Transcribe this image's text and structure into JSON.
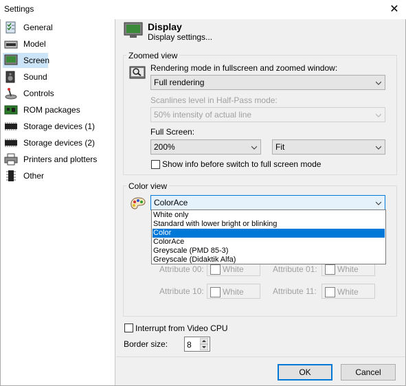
{
  "window": {
    "title": "Settings",
    "close_glyph": "✕"
  },
  "sidebar": {
    "items": [
      {
        "label": "General",
        "icon": "general-checklist-icon"
      },
      {
        "label": "Model",
        "icon": "computer-model-icon"
      },
      {
        "label": "Screen",
        "icon": "monitor-screen-icon",
        "selected": true
      },
      {
        "label": "Sound",
        "icon": "speaker-icon"
      },
      {
        "label": "Controls",
        "icon": "joystick-icon"
      },
      {
        "label": "ROM packages",
        "icon": "circuit-board-icon"
      },
      {
        "label": "Storage devices (1)",
        "icon": "chip-icon"
      },
      {
        "label": "Storage devices (2)",
        "icon": "chip-icon"
      },
      {
        "label": "Printers and plotters",
        "icon": "printer-icon"
      },
      {
        "label": "Other",
        "icon": "ic-chip-icon"
      }
    ]
  },
  "header": {
    "title": "Display",
    "subtitle": "Display settings..."
  },
  "zoomed": {
    "group_label": "Zoomed view",
    "rendering_label": "Rendering mode in fullscreen and zoomed window:",
    "rendering_value": "Full rendering",
    "scanlines_label": "Scanlines level in Half-Pass mode:",
    "scanlines_value": "50% intensity of actual line",
    "fullscreen_label": "Full Screen:",
    "zoom_value": "200%",
    "fit_value": "Fit",
    "show_info_label": "Show info before switch to full screen mode"
  },
  "color": {
    "group_label": "Color view",
    "selected_value": "ColorAce",
    "options": [
      "White only",
      "Standard with lower bright or blinking",
      "Color",
      "ColorAce",
      "Greyscale (PMD 85-3)",
      "Greyscale (Didaktik Alfa)"
    ],
    "highlighted_option": "Color",
    "attributes": [
      {
        "label": "Attribute 00:",
        "value": "White"
      },
      {
        "label": "Attribute 01:",
        "value": "White"
      },
      {
        "label": "Attribute 10:",
        "value": "White"
      },
      {
        "label": "Attribute 11:",
        "value": "White"
      }
    ]
  },
  "interrupt_label": "Interrupt from Video CPU",
  "border": {
    "label": "Border size:",
    "value": "8"
  },
  "buttons": {
    "ok": "OK",
    "cancel": "Cancel"
  },
  "colors": {
    "accent": "#0078d7",
    "selection_bg": "#cce4f7"
  }
}
